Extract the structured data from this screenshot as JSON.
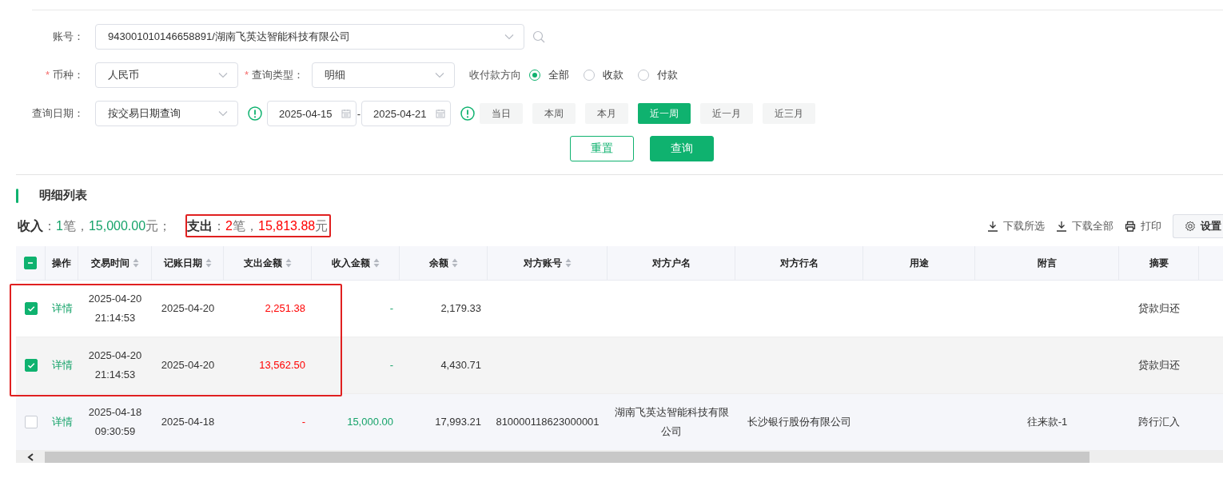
{
  "filters": {
    "account": {
      "label": "账号：",
      "value": "943001010146658891/湖南飞英达智能科技有限公司"
    },
    "currency": {
      "required_mark": "*",
      "label": "币种：",
      "value": "人民币"
    },
    "query_type": {
      "required_mark": "*",
      "label": "查询类型：",
      "value": "明细"
    },
    "direction": {
      "label": "收付款方向",
      "options": [
        {
          "label": "全部",
          "selected": true
        },
        {
          "label": "收款",
          "selected": false
        },
        {
          "label": "付款",
          "selected": false
        }
      ]
    },
    "date": {
      "label": "查询日期：",
      "mode": "按交易日期查询",
      "start": "2025-04-15",
      "separator": "-",
      "end": "2025-04-21",
      "presets": [
        {
          "label": "当日",
          "selected": false
        },
        {
          "label": "本周",
          "selected": false
        },
        {
          "label": "本月",
          "selected": false
        },
        {
          "label": "近一周",
          "selected": true
        },
        {
          "label": "近一月",
          "selected": false
        },
        {
          "label": "近三月",
          "selected": false
        }
      ]
    },
    "buttons": [
      {
        "label": "重置",
        "kind": "secondary"
      },
      {
        "label": "查询",
        "kind": "primary"
      }
    ]
  },
  "list": {
    "title": "明细列表",
    "summary": [
      {
        "kind": "income",
        "flagged": false,
        "segments": [
          {
            "kind": "label",
            "text": "收入"
          },
          {
            "kind": "punct",
            "text": "："
          },
          {
            "kind": "value",
            "text": "1"
          },
          {
            "kind": "unit",
            "text": "笔"
          },
          {
            "kind": "punct",
            "text": "，"
          },
          {
            "kind": "value",
            "text": "15,000.00"
          },
          {
            "kind": "unit",
            "text": "元"
          },
          {
            "kind": "punct",
            "text": "；"
          }
        ]
      },
      {
        "kind": "expense",
        "flagged": true,
        "segments": [
          {
            "kind": "label",
            "text": "支出"
          },
          {
            "kind": "punct",
            "text": "："
          },
          {
            "kind": "value",
            "text": "2"
          },
          {
            "kind": "unit",
            "text": "笔"
          },
          {
            "kind": "punct",
            "text": "，"
          },
          {
            "kind": "value",
            "text": "15,813.88"
          },
          {
            "kind": "unit",
            "text": "元"
          }
        ]
      }
    ],
    "toolbar": [
      {
        "label": "下载所选",
        "kind": "download"
      },
      {
        "label": "下载全部",
        "kind": "download"
      },
      {
        "label": "打印",
        "kind": "print"
      },
      {
        "label": "设置",
        "kind": "settings"
      }
    ],
    "table": {
      "select_all_indeterminate": true,
      "columns": [
        {
          "label": "操作",
          "sortable": false
        },
        {
          "label": "交易时间",
          "sortable": true
        },
        {
          "label": "记账日期",
          "sortable": true
        },
        {
          "label": "支出金额",
          "sortable": true
        },
        {
          "label": "收入金额",
          "sortable": true
        },
        {
          "label": "余额",
          "sortable": true
        },
        {
          "label": "对方账号",
          "sortable": true
        },
        {
          "label": "对方户名",
          "sortable": false
        },
        {
          "label": "对方行名",
          "sortable": false
        },
        {
          "label": "用途",
          "sortable": false
        },
        {
          "label": "附言",
          "sortable": false
        },
        {
          "label": "摘要",
          "sortable": false
        }
      ],
      "rows": [
        {
          "selected": true,
          "flagged": true,
          "cells": [
            "详情",
            "2025-04-20 21:14:53",
            "2025-04-20",
            "2,251.38",
            "-",
            "2,179.33",
            "",
            "",
            "",
            "",
            "",
            "贷款归还"
          ]
        },
        {
          "selected": true,
          "flagged": true,
          "cells": [
            "详情",
            "2025-04-20 21:14:53",
            "2025-04-20",
            "13,562.50",
            "-",
            "4,430.71",
            "",
            "",
            "",
            "",
            "",
            "贷款归还"
          ]
        },
        {
          "selected": false,
          "flagged": false,
          "cells": [
            "详情",
            "2025-04-18 09:30:59",
            "2025-04-18",
            "-",
            "15,000.00",
            "17,993.21",
            "810000118623000001",
            "湖南飞英达智能科技有限公司",
            "长沙银行股份有限公司",
            "",
            "往来款-1",
            "跨行汇入"
          ]
        }
      ]
    }
  }
}
